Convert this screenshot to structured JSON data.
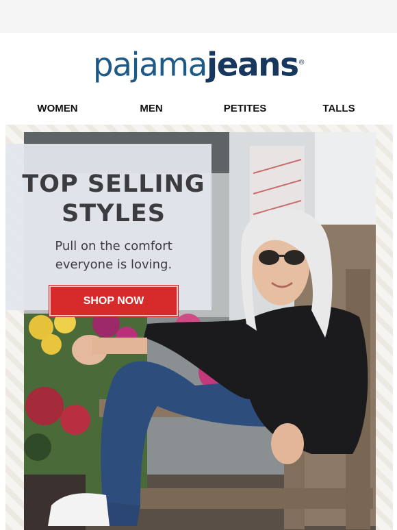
{
  "brand": {
    "logo_part1": "pajama",
    "logo_part2": "jeans",
    "trademark": "®"
  },
  "nav": {
    "items": [
      "WOMEN",
      "MEN",
      "PETITES",
      "TALLS"
    ]
  },
  "hero": {
    "title": "TOP SELLING STYLES",
    "subtitle_line1": "Pull on the comfort",
    "subtitle_line2": "everyone is loving.",
    "cta_label": "SHOP NOW",
    "accent_color": "#d72a2a"
  }
}
